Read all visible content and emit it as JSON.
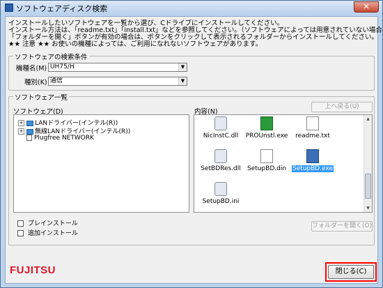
{
  "window": {
    "title": "ソフトウェアディスク検索",
    "close_glyph": "✕"
  },
  "info": {
    "line1": "インストールしたいソフトウェアを一覧から選び、Cドライブにインストールしてください。",
    "line2": "インストール方法は、「readme.txt」「install.txt」などを参照してください。（ソフトウェアによっては用意されていない場合もあります）",
    "line3": "「フォルダーを開く」ボタンが有効の場合は、ボタンをクリックして表示されるフォルダーからインストールしてください。",
    "line4": "★★ 注意 ★★ お使いの機種によっては、ご利用になれないソフトウェアがあります。"
  },
  "search": {
    "legend": "ソフトウェアの検索条件",
    "model_label": "機種名(M)",
    "model_value": "UH75/H",
    "type_label": "種別(K)",
    "type_value": "通信"
  },
  "list": {
    "legend": "ソフトウェア一覧",
    "software_label": "ソフトウェア(D)",
    "contents_label": "内容(N)",
    "back_button": "上へ戻る(U)",
    "tree": [
      {
        "label": "LANドライバー(インテル(R))",
        "expander": "+"
      },
      {
        "label": "無線LANドライバー(インテル(R))",
        "expander": "+"
      },
      {
        "label": "Plugfree NETWORK",
        "expander": ""
      }
    ],
    "files": [
      {
        "name": "NicInstC.dll",
        "icon": "cfg-file-icon"
      },
      {
        "name": "PROUnstl.exe",
        "icon": "app-file-icon"
      },
      {
        "name": "readme.txt",
        "icon": "text-file-icon"
      },
      {
        "name": "SetBDRes.dll",
        "icon": "cfg-file-icon"
      },
      {
        "name": "SetupBD.din",
        "icon": "text-file-icon"
      },
      {
        "name": "SetupBD.exe",
        "icon": "setup-file-icon",
        "selected": true
      },
      {
        "name": "SetupBD.ini",
        "icon": "cfg-file-icon"
      }
    ],
    "preinstall": "プレインストール",
    "add_install": "追加インストール",
    "open_folder_button": "フォルダーを開く(O)"
  },
  "footer": {
    "logo": "FUJITSU",
    "close_button": "閉じる(C)",
    "highlight_color": "#ff0000"
  }
}
